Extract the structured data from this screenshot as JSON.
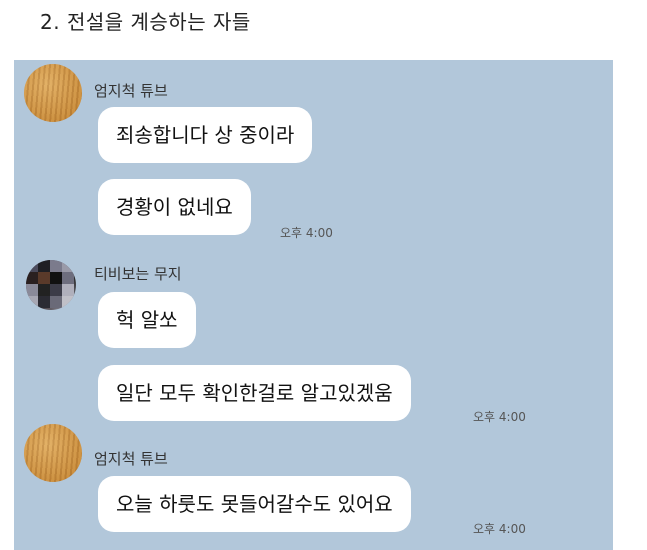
{
  "heading": "2. 전설을 계승하는 자들",
  "messages": [
    {
      "sender": "엄지척 튜브",
      "bubbles": [
        "죄송합니다 상 중이라",
        "경황이 없네요"
      ],
      "time": "오후 4:00"
    },
    {
      "sender": "티비보는 무지",
      "bubbles": [
        "헉 알쏘",
        "일단 모두 확인한걸로 알고있겠움"
      ],
      "time": "오후 4:00"
    },
    {
      "sender": "엄지척 튜브",
      "bubbles": [
        "오늘 하룻도 못들어갈수도 있어요"
      ],
      "time": "오후 4:00"
    }
  ]
}
